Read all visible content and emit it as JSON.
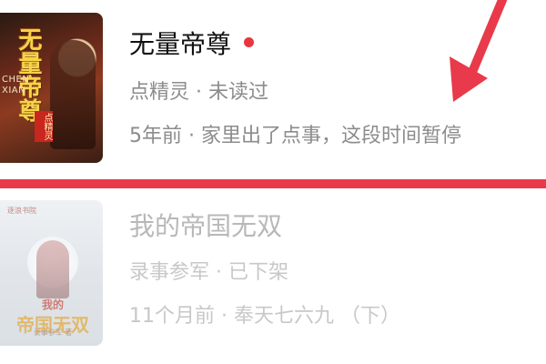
{
  "books": [
    {
      "title": "无量帝尊",
      "unread": true,
      "meta": "点精灵 · 未读过",
      "latest": "5年前 · 家里出了点事，这段时间暂停",
      "cover": {
        "title_text": "无量帝尊",
        "en_text": "CHEN\nXIAN",
        "tag_text": "点精灵",
        "tag_small": "著作"
      },
      "greyed_out": false
    },
    {
      "title": "我的帝国无双",
      "unread": false,
      "meta": "录事参军 · 已下架",
      "latest": "11个月前 · 奉天七六九 （下）",
      "cover": {
        "publisher": "逐浪书院",
        "title_small": "我的",
        "title_text": "帝国无双",
        "sub_text": "录事参军 著"
      },
      "greyed_out": true
    }
  ],
  "colors": {
    "annotation": "#e83a4a",
    "unread_dot": "#e8363e",
    "title_active": "#111111",
    "meta_active": "#8c8c8c",
    "greyed_text": "#c8c8c8"
  },
  "icons": {
    "annotation_arrow": "arrow-down-left-icon",
    "unread_indicator": "dot-icon"
  }
}
